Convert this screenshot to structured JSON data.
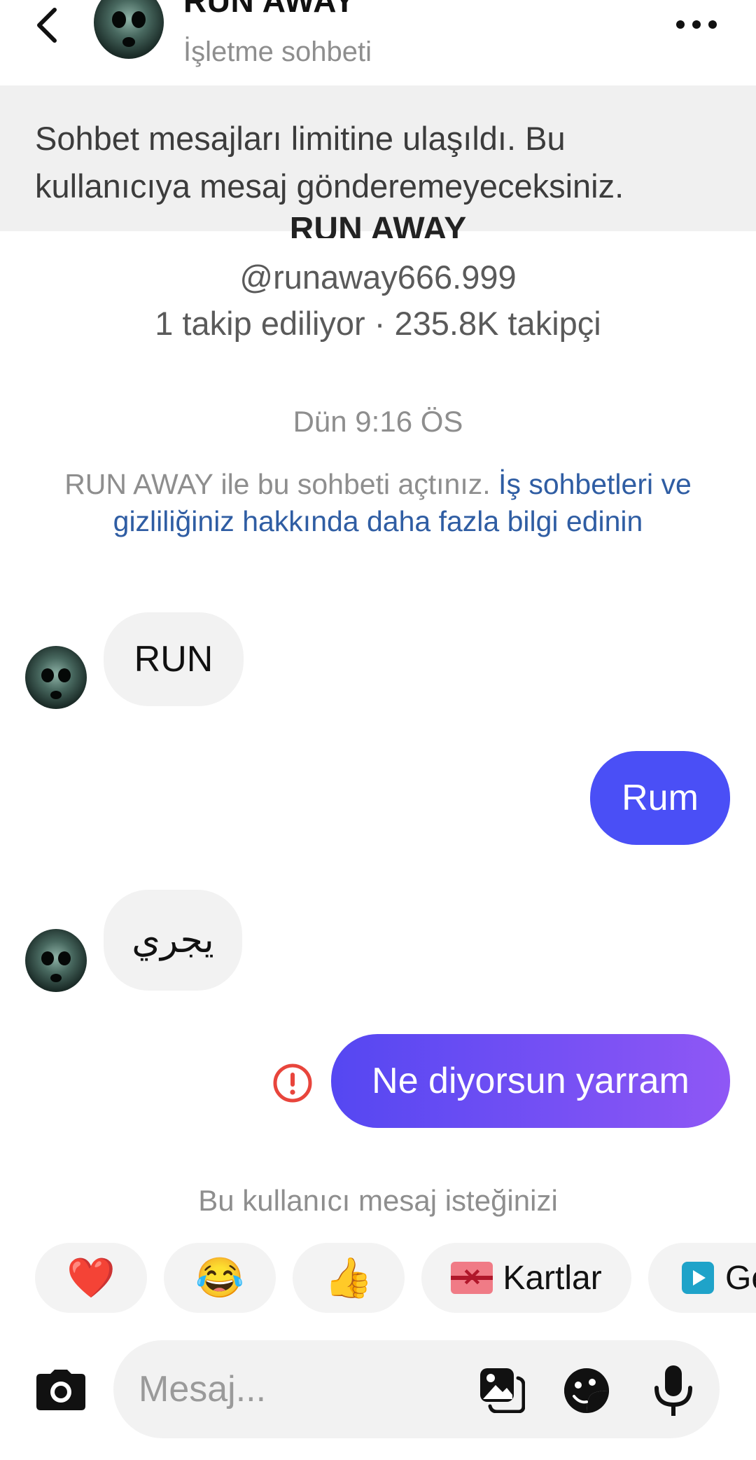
{
  "header": {
    "title": "RUN AWAY",
    "subtitle": "İşletme sohbeti"
  },
  "banner": {
    "text": "Sohbet mesajları limitine ulaşıldı. Bu kullanıcıya mesaj gönderemeyeceksiniz."
  },
  "profile": {
    "name": "RUN AWAY",
    "handle": "@runaway666.999",
    "stats": "1 takip ediliyor · 235.8K takipçi"
  },
  "chat": {
    "timestamp": "Dün 9:16 ÖS",
    "info_text": "RUN AWAY ile bu sohbeti açtınız.",
    "info_link": "İş sohbetleri ve gizliliğiniz hakkında daha fazla bilgi edinin",
    "messages": [
      {
        "from": "them",
        "text": "RUN"
      },
      {
        "from": "me",
        "text": "Rum"
      },
      {
        "from": "them",
        "text": "يجري"
      },
      {
        "from": "me",
        "text": "Ne diyorsun yarram",
        "status": "failed"
      }
    ],
    "request_notice": "Bu kullanıcı mesaj isteğinizi"
  },
  "quick_replies": [
    {
      "label": "❤️",
      "icon": "heart-emoji"
    },
    {
      "label": "😂",
      "icon": "laughing-emoji"
    },
    {
      "label": "👍",
      "icon": "thumbs-up-emoji"
    },
    {
      "label": "Kartlar",
      "icon": "gift-card-icon"
    },
    {
      "label": "Ge",
      "icon": "play-icon"
    }
  ],
  "composer": {
    "placeholder": "Mesaj..."
  },
  "colors": {
    "bubble_blue": "#4a4ff6",
    "bubble_gradient_start": "#5547f2",
    "bubble_gradient_end": "#8f57f5",
    "link": "#2f5da3",
    "error": "#e8453c"
  }
}
